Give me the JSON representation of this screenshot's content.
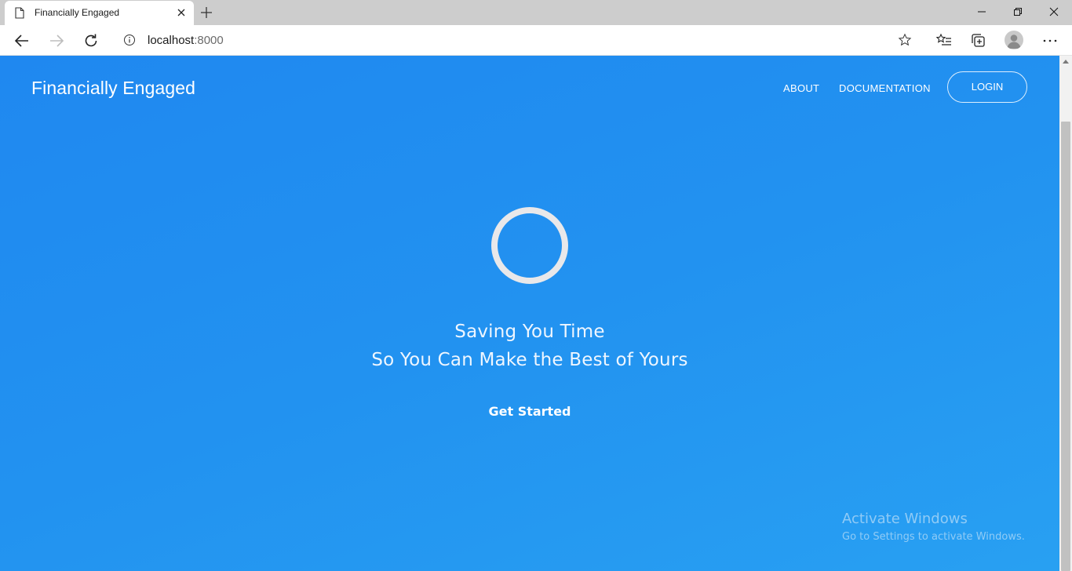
{
  "browser": {
    "tab": {
      "title": "Financially Engaged",
      "page_icon": "page-icon",
      "close_icon": "close-icon"
    },
    "new_tab_icon": "plus-icon",
    "window_controls": [
      "minimize-icon",
      "restore-icon",
      "close-icon"
    ],
    "toolbar": {
      "back_icon": "arrow-left-icon",
      "forward_icon": "arrow-right-icon",
      "refresh_icon": "refresh-icon",
      "info_icon": "info-icon",
      "url_host": "localhost",
      "url_port": ":8000",
      "favorite_icon": "star-icon",
      "favorites_icon": "favorites-icon",
      "collections_icon": "collections-icon",
      "profile_icon": "avatar",
      "more_icon": "ellipsis-icon"
    }
  },
  "page": {
    "brand": "Financially Engaged",
    "nav": {
      "about": "ABOUT",
      "documentation": "DOCUMENTATION",
      "login": "LOGIN"
    },
    "hero": {
      "line1": "Saving You Time",
      "line2": "So You Can Make the Best of Yours",
      "cta": "Get Started"
    }
  },
  "os_watermark": {
    "title": "Activate Windows",
    "subtitle": "Go to Settings to activate Windows."
  },
  "colors": {
    "page_gradient_start": "#1f88f0",
    "page_gradient_end": "#28a0f2",
    "ring": "#e8e8ea",
    "tabstrip": "#cdcdcd"
  }
}
